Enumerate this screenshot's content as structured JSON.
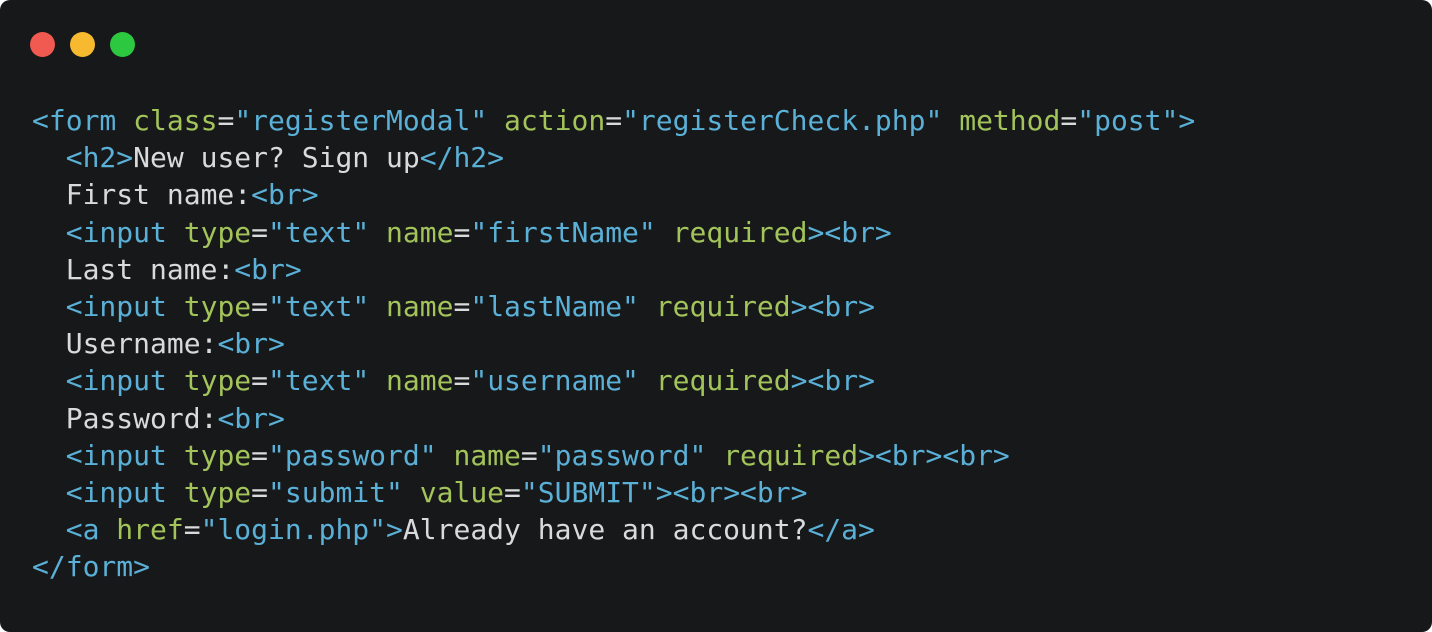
{
  "window": {
    "buttons": [
      {
        "name": "close",
        "color": "#f05a50"
      },
      {
        "name": "minimize",
        "color": "#f6b930"
      },
      {
        "name": "maximize",
        "color": "#2bc840"
      }
    ]
  },
  "colors": {
    "background": "#17181a",
    "tag": "#5ab0d6",
    "attribute": "#a3c45a",
    "string": "#5ab0d6",
    "text": "#d9dadb"
  },
  "code": {
    "lines": [
      [
        [
          "tag",
          "<form"
        ],
        [
          "txt",
          " "
        ],
        [
          "attr",
          "class"
        ],
        [
          "eq",
          "="
        ],
        [
          "str",
          "\"registerModal\""
        ],
        [
          "txt",
          " "
        ],
        [
          "attr",
          "action"
        ],
        [
          "eq",
          "="
        ],
        [
          "str",
          "\"registerCheck.php\""
        ],
        [
          "txt",
          " "
        ],
        [
          "attr",
          "method"
        ],
        [
          "eq",
          "="
        ],
        [
          "str",
          "\"post\""
        ],
        [
          "tag",
          ">"
        ]
      ],
      [
        [
          "txt",
          "  "
        ],
        [
          "tag",
          "<h2>"
        ],
        [
          "txt",
          "New user? Sign up"
        ],
        [
          "tag",
          "</h2>"
        ]
      ],
      [
        [
          "txt",
          "  First name:"
        ],
        [
          "tag",
          "<br>"
        ]
      ],
      [
        [
          "txt",
          "  "
        ],
        [
          "tag",
          "<input"
        ],
        [
          "txt",
          " "
        ],
        [
          "attr",
          "type"
        ],
        [
          "eq",
          "="
        ],
        [
          "str",
          "\"text\""
        ],
        [
          "txt",
          " "
        ],
        [
          "attr",
          "name"
        ],
        [
          "eq",
          "="
        ],
        [
          "str",
          "\"firstName\""
        ],
        [
          "txt",
          " "
        ],
        [
          "attr",
          "required"
        ],
        [
          "tag",
          "><br>"
        ]
      ],
      [
        [
          "txt",
          "  Last name:"
        ],
        [
          "tag",
          "<br>"
        ]
      ],
      [
        [
          "txt",
          "  "
        ],
        [
          "tag",
          "<input"
        ],
        [
          "txt",
          " "
        ],
        [
          "attr",
          "type"
        ],
        [
          "eq",
          "="
        ],
        [
          "str",
          "\"text\""
        ],
        [
          "txt",
          " "
        ],
        [
          "attr",
          "name"
        ],
        [
          "eq",
          "="
        ],
        [
          "str",
          "\"lastName\""
        ],
        [
          "txt",
          " "
        ],
        [
          "attr",
          "required"
        ],
        [
          "tag",
          "><br>"
        ]
      ],
      [
        [
          "txt",
          "  Username:"
        ],
        [
          "tag",
          "<br>"
        ]
      ],
      [
        [
          "txt",
          "  "
        ],
        [
          "tag",
          "<input"
        ],
        [
          "txt",
          " "
        ],
        [
          "attr",
          "type"
        ],
        [
          "eq",
          "="
        ],
        [
          "str",
          "\"text\""
        ],
        [
          "txt",
          " "
        ],
        [
          "attr",
          "name"
        ],
        [
          "eq",
          "="
        ],
        [
          "str",
          "\"username\""
        ],
        [
          "txt",
          " "
        ],
        [
          "attr",
          "required"
        ],
        [
          "tag",
          "><br>"
        ]
      ],
      [
        [
          "txt",
          "  Password:"
        ],
        [
          "tag",
          "<br>"
        ]
      ],
      [
        [
          "txt",
          "  "
        ],
        [
          "tag",
          "<input"
        ],
        [
          "txt",
          " "
        ],
        [
          "attr",
          "type"
        ],
        [
          "eq",
          "="
        ],
        [
          "str",
          "\"password\""
        ],
        [
          "txt",
          " "
        ],
        [
          "attr",
          "name"
        ],
        [
          "eq",
          "="
        ],
        [
          "str",
          "\"password\""
        ],
        [
          "txt",
          " "
        ],
        [
          "attr",
          "required"
        ],
        [
          "tag",
          "><br><br>"
        ]
      ],
      [
        [
          "txt",
          "  "
        ],
        [
          "tag",
          "<input"
        ],
        [
          "txt",
          " "
        ],
        [
          "attr",
          "type"
        ],
        [
          "eq",
          "="
        ],
        [
          "str",
          "\"submit\""
        ],
        [
          "txt",
          " "
        ],
        [
          "attr",
          "value"
        ],
        [
          "eq",
          "="
        ],
        [
          "str",
          "\"SUBMIT\""
        ],
        [
          "tag",
          "><br><br>"
        ]
      ],
      [
        [
          "txt",
          "  "
        ],
        [
          "tag",
          "<a"
        ],
        [
          "txt",
          " "
        ],
        [
          "attr",
          "href"
        ],
        [
          "eq",
          "="
        ],
        [
          "str",
          "\"login.php\""
        ],
        [
          "tag",
          ">"
        ],
        [
          "txt",
          "Already have an account?"
        ],
        [
          "tag",
          "</a>"
        ]
      ],
      [
        [
          "tag",
          "</form>"
        ]
      ]
    ]
  }
}
